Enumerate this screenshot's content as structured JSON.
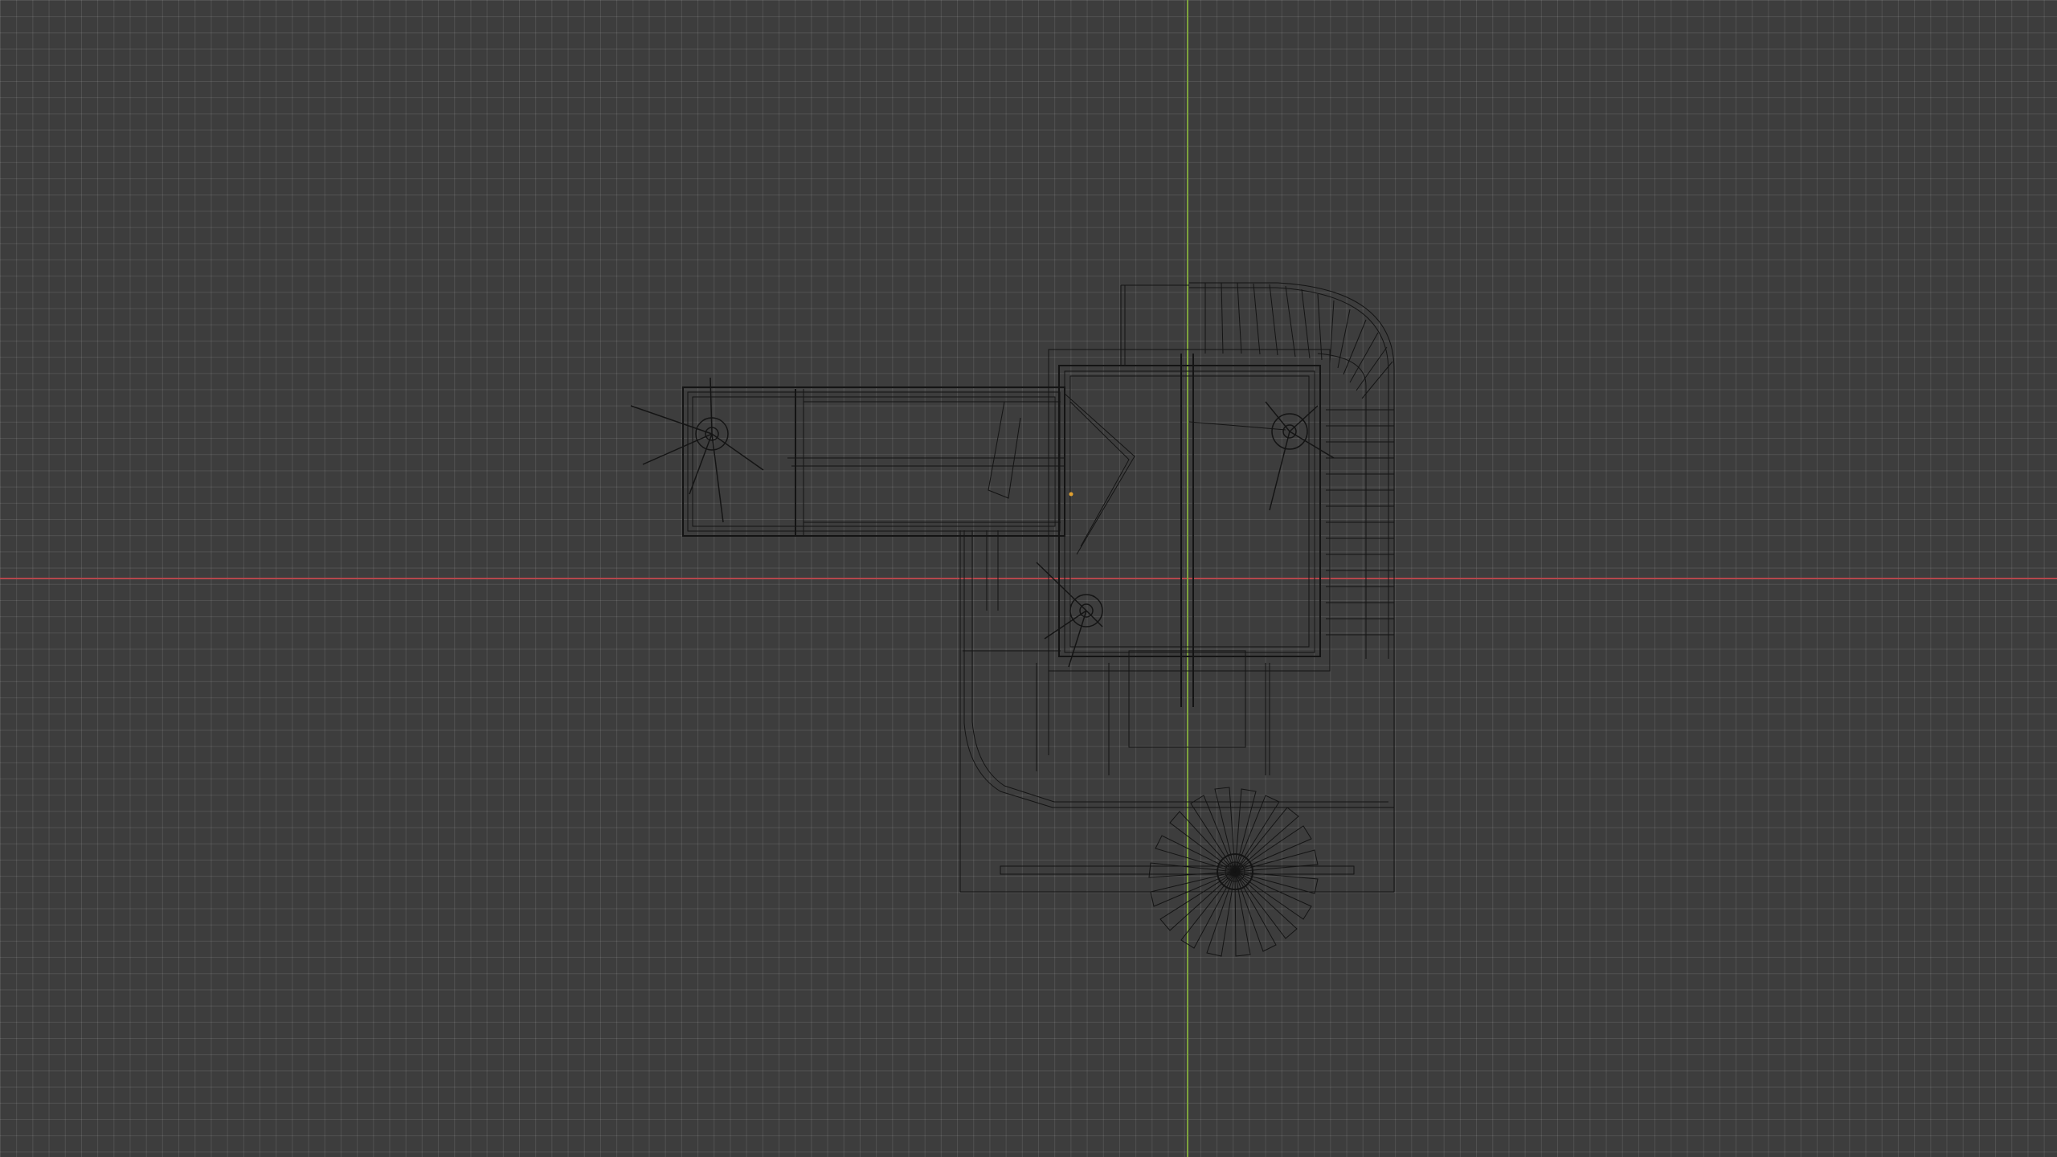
{
  "viewport": {
    "background": "#3d3d3d",
    "grid_color": "#505050",
    "x_axis_color": "#b5474c",
    "y_axis_color": "#7da33c",
    "wire_color": "#141414",
    "origin_marker_color": "#e0a030",
    "shading_mode": "wireframe",
    "view": "top-orthographic"
  }
}
